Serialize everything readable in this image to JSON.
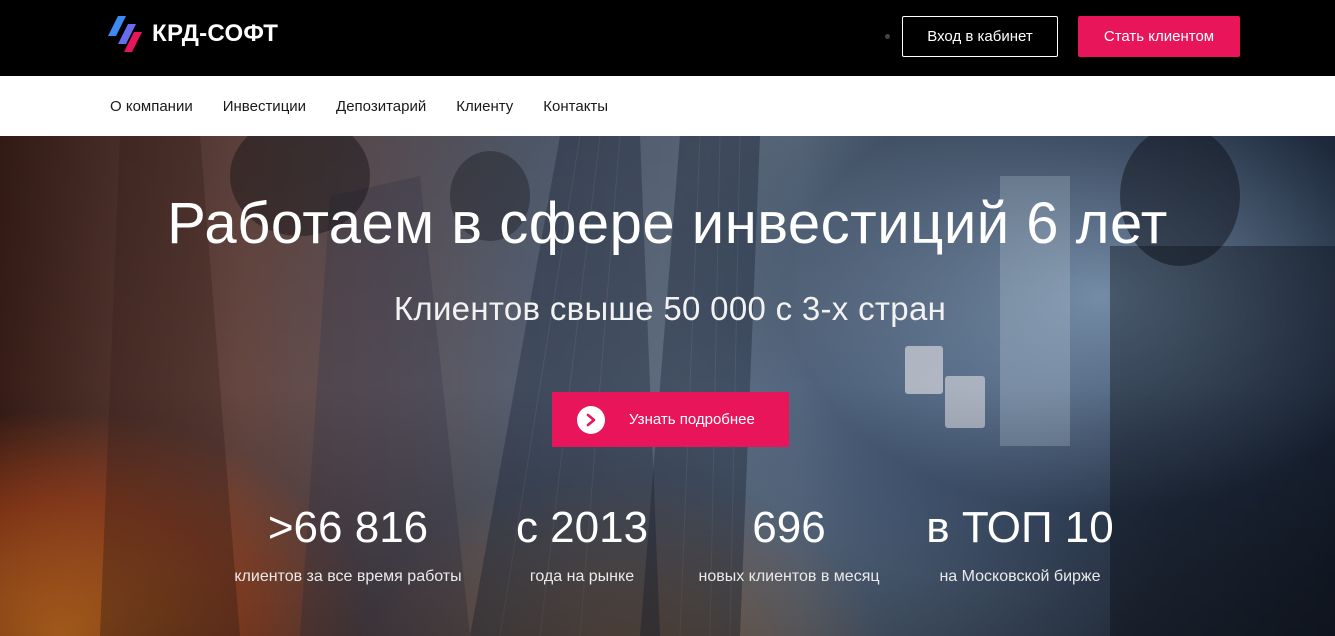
{
  "header": {
    "logo_text": "КРД-СОФТ",
    "login_label": "Вход в кабинет",
    "become_client_label": "Стать клиентом",
    "accent_color": "#e8155a"
  },
  "nav": {
    "items": [
      {
        "label": "О компании"
      },
      {
        "label": "Инвестиции"
      },
      {
        "label": "Депозитарий"
      },
      {
        "label": "Клиенту"
      },
      {
        "label": "Контакты"
      }
    ]
  },
  "hero": {
    "title": "Работаем в сфере инвестиций 6 лет",
    "subtitle": "Клиентов свыше 50 000 с 3-х стран",
    "cta_label": "Узнать подробнее",
    "cta_icon": "chevron-right-icon"
  },
  "stats": [
    {
      "value": ">66 816",
      "label": "клиентов за все время работы"
    },
    {
      "value": "с 2013",
      "label": "года на рынке"
    },
    {
      "value": "696",
      "label": "новых клиентов в месяц"
    },
    {
      "value": "в ТОП 10",
      "label": "на Московской бирже"
    }
  ]
}
